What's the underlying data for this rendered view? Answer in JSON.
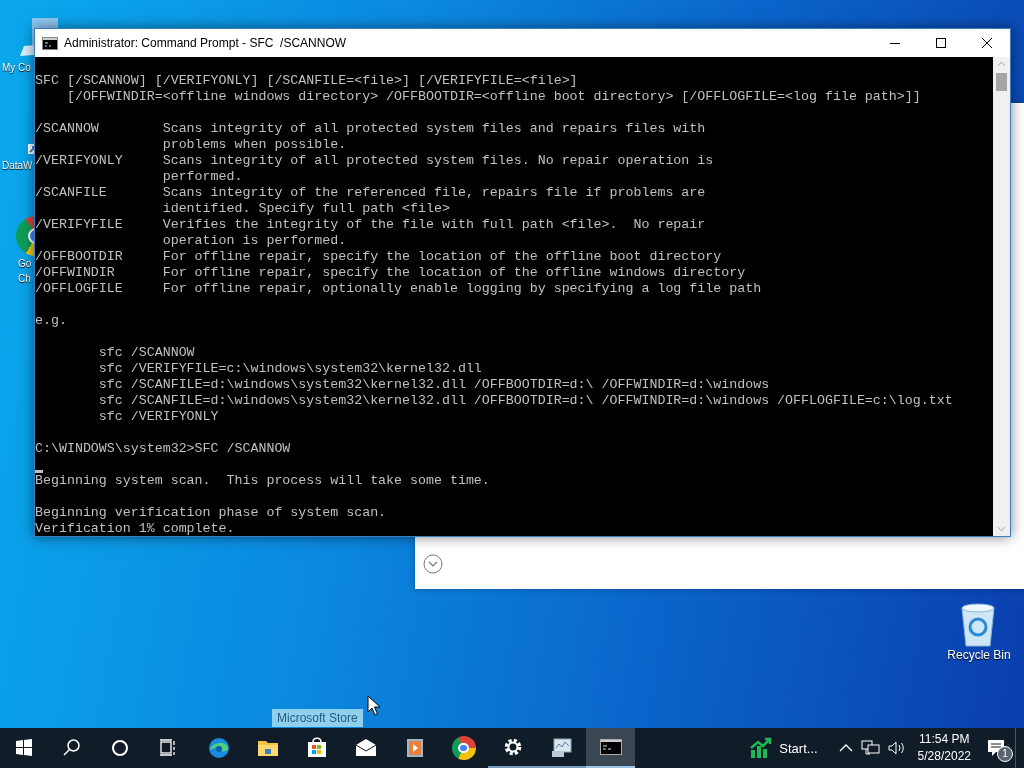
{
  "desktop_icons": [
    {
      "kind": "computer",
      "label_lines": [
        "My Co"
      ]
    },
    {
      "kind": "app",
      "label_lines": [
        "DataW"
      ]
    },
    {
      "kind": "chrome",
      "label_lines": [
        "Go",
        "Ch"
      ]
    },
    {
      "kind": "recycle-bin",
      "label_lines": [
        "Recycle Bin"
      ]
    }
  ],
  "console_window": {
    "title": "Administrator: Command Prompt - SFC  /SCANNOW",
    "lines": [
      {
        "kind": "text",
        "text": "SFC [/SCANNOW] [/VERIFYONLY] [/SCANFILE=<file>] [/VERIFYFILE=<file>]"
      },
      {
        "kind": "text",
        "text": "    [/OFFWINDIR=<offline windows directory> /OFFBOOTDIR=<offline boot directory> [/OFFLOGFILE=<log file path>]]"
      },
      {
        "kind": "blank"
      },
      {
        "kind": "text",
        "text": "/SCANNOW        Scans integrity of all protected system files and repairs files with"
      },
      {
        "kind": "text",
        "text": "                problems when possible."
      },
      {
        "kind": "text",
        "text": "/VERIFYONLY     Scans integrity of all protected system files. No repair operation is"
      },
      {
        "kind": "text",
        "text": "                performed."
      },
      {
        "kind": "text",
        "text": "/SCANFILE       Scans integrity of the referenced file, repairs file if problems are"
      },
      {
        "kind": "text",
        "text": "                identified. Specify full path <file>"
      },
      {
        "kind": "text",
        "text": "/VERIFYFILE     Verifies the integrity of the file with full path <file>.  No repair"
      },
      {
        "kind": "text",
        "text": "                operation is performed."
      },
      {
        "kind": "text",
        "text": "/OFFBOOTDIR     For offline repair, specify the location of the offline boot directory"
      },
      {
        "kind": "text",
        "text": "/OFFWINDIR      For offline repair, specify the location of the offline windows directory"
      },
      {
        "kind": "text",
        "text": "/OFFLOGFILE     For offline repair, optionally enable logging by specifying a log file path"
      },
      {
        "kind": "blank"
      },
      {
        "kind": "text",
        "text": "e.g."
      },
      {
        "kind": "blank"
      },
      {
        "kind": "text",
        "text": "        sfc /SCANNOW"
      },
      {
        "kind": "text",
        "text": "        sfc /VERIFYFILE=c:\\windows\\system32\\kernel32.dll"
      },
      {
        "kind": "text",
        "text": "        sfc /SCANFILE=d:\\windows\\system32\\kernel32.dll /OFFBOOTDIR=d:\\ /OFFWINDIR=d:\\windows"
      },
      {
        "kind": "text",
        "text": "        sfc /SCANFILE=d:\\windows\\system32\\kernel32.dll /OFFBOOTDIR=d:\\ /OFFWINDIR=d:\\windows /OFFLOGFILE=c:\\log.txt"
      },
      {
        "kind": "text",
        "text": "        sfc /VERIFYONLY"
      },
      {
        "kind": "blank"
      },
      {
        "kind": "text",
        "text": "C:\\WINDOWS\\system32>SFC /SCANNOW"
      },
      {
        "kind": "cursor"
      },
      {
        "kind": "text",
        "text": "Beginning system scan.  This process will take some time."
      },
      {
        "kind": "blank"
      },
      {
        "kind": "text",
        "text": "Beginning verification phase of system scan."
      },
      {
        "kind": "text",
        "text": "Verification 1% complete."
      }
    ]
  },
  "tooltip": {
    "text": "Microsoft Store"
  },
  "taskbar": {
    "items": [
      {
        "kind": "start",
        "running": false,
        "selected": false
      },
      {
        "kind": "search",
        "running": false,
        "selected": false
      },
      {
        "kind": "cortana",
        "running": false,
        "selected": false
      },
      {
        "kind": "task-view",
        "running": false,
        "selected": false
      },
      {
        "kind": "edge",
        "running": false,
        "selected": false
      },
      {
        "kind": "folder",
        "running": false,
        "selected": false
      },
      {
        "kind": "store",
        "running": false,
        "selected": false
      },
      {
        "kind": "mail",
        "running": false,
        "selected": false
      },
      {
        "kind": "media",
        "running": false,
        "selected": false
      },
      {
        "kind": "chrome",
        "running": false,
        "selected": false
      },
      {
        "kind": "settings",
        "running": true,
        "selected": false
      },
      {
        "kind": "monitor",
        "running": true,
        "selected": false
      },
      {
        "kind": "console",
        "running": true,
        "selected": true
      }
    ],
    "tray": {
      "app_text": "Start...",
      "time": "11:54 PM",
      "date": "5/28/2022",
      "notification_count": "1"
    }
  }
}
